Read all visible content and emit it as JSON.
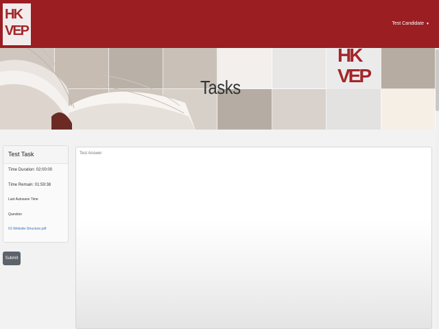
{
  "navbar": {
    "logo_text": "HK VEP",
    "user_name": "Test Candidate",
    "brand_color": "#9a1e22"
  },
  "banner": {
    "title": "Tasks",
    "logo_text": "HK VEP"
  },
  "task_panel": {
    "title": "Test Task",
    "time_duration": "Time Duration: 02:00:00",
    "time_remain": "Time Remain: 01:59:38",
    "last_autosave": "Last Autosave Time",
    "question_label": "Question",
    "question_file": "01-Website-Structure.pdf",
    "submit_label": "Submit"
  },
  "answer": {
    "placeholder": "Test Answer"
  }
}
